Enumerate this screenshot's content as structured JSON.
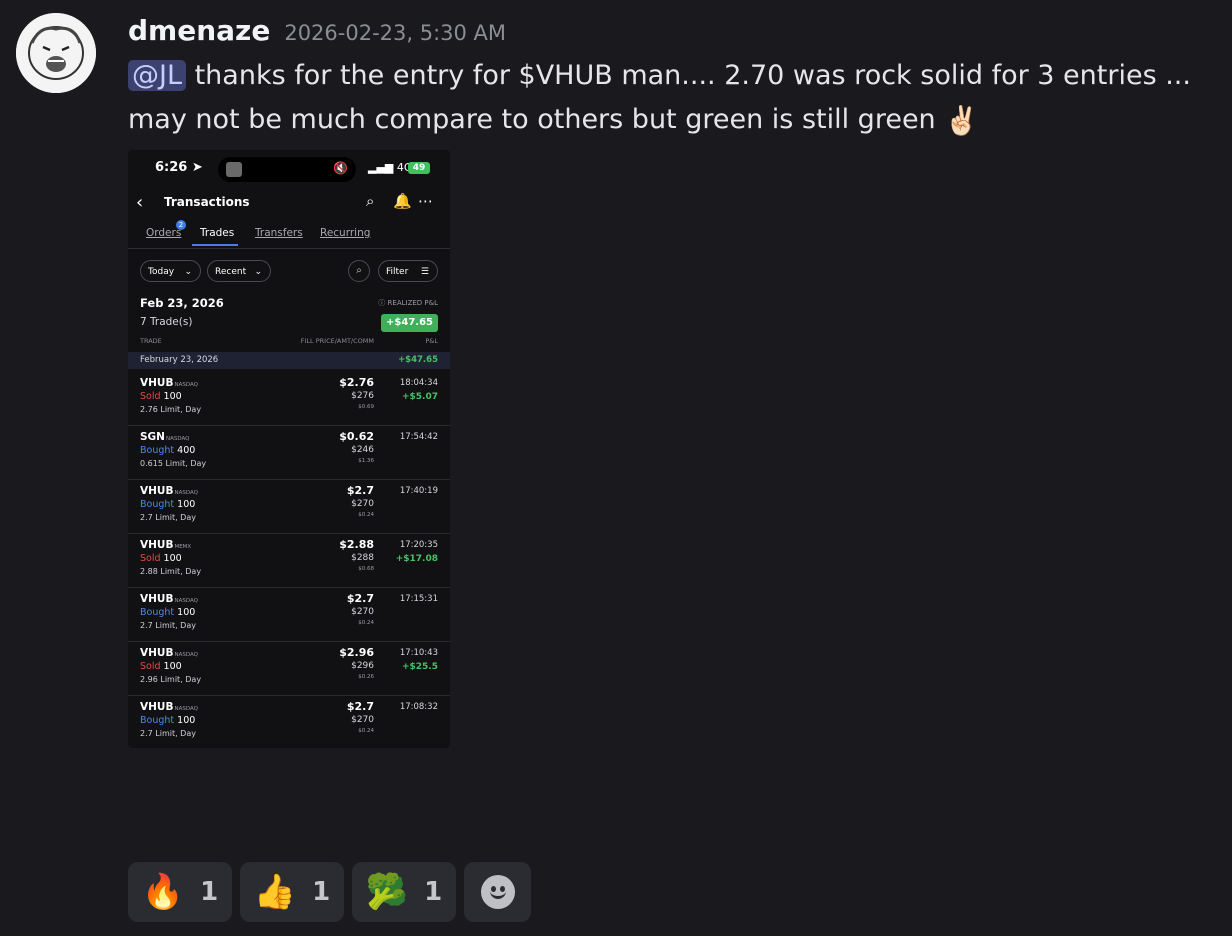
{
  "message": {
    "author": "dmenaze",
    "timestamp": "2026-02-23, 5:30 AM",
    "mention": "@JL",
    "text_line1": " thanks for the entry for $VHUB man.... 2.70 was rock solid for 3 entries ...",
    "text_line2": "may not be much compare to others but green is still green",
    "emoji": "✌🏻"
  },
  "attachment": {
    "status": {
      "time": "6:26",
      "signal": "4G",
      "battery": "49"
    },
    "nav": {
      "title": "Transactions"
    },
    "tabs": [
      {
        "label": "Orders",
        "badge": "2"
      },
      {
        "label": "Trades",
        "active": true
      },
      {
        "label": "Transfers"
      },
      {
        "label": "Recurring"
      }
    ],
    "filters": {
      "period": "Today",
      "sort": "Recent",
      "filter": "Filter"
    },
    "summary": {
      "date": "Feb 23, 2026",
      "trade_count": "7 Trade(s)",
      "realized_label": "REALIZED P&L",
      "realized_value": "+$47.65"
    },
    "columns": {
      "trade": "TRADE",
      "fill": "FILL PRICE/AMT/COMM",
      "pnl": "P&L"
    },
    "day_bar": {
      "date": "February 23, 2026",
      "pnl": "+$47.65"
    },
    "trades": [
      {
        "symbol": "VHUB",
        "exchange": "NASDAQ",
        "side": "Sold",
        "qty": "100",
        "limit": "2.76 Limit, Day",
        "price": "$2.76",
        "amount": "$276",
        "comm": "$0.69",
        "time": "18:04:34",
        "pnl": "+$5.07"
      },
      {
        "symbol": "SGN",
        "exchange": "NASDAQ",
        "side": "Bought",
        "qty": "400",
        "limit": "0.615 Limit, Day",
        "price": "$0.62",
        "amount": "$246",
        "comm": "$1.36",
        "time": "17:54:42",
        "pnl": ""
      },
      {
        "symbol": "VHUB",
        "exchange": "NASDAQ",
        "side": "Bought",
        "qty": "100",
        "limit": "2.7 Limit, Day",
        "price": "$2.7",
        "amount": "$270",
        "comm": "$0.24",
        "time": "17:40:19",
        "pnl": ""
      },
      {
        "symbol": "VHUB",
        "exchange": "MEMX",
        "side": "Sold",
        "qty": "100",
        "limit": "2.88 Limit, Day",
        "price": "$2.88",
        "amount": "$288",
        "comm": "$0.68",
        "time": "17:20:35",
        "pnl": "+$17.08"
      },
      {
        "symbol": "VHUB",
        "exchange": "NASDAQ",
        "side": "Bought",
        "qty": "100",
        "limit": "2.7 Limit, Day",
        "price": "$2.7",
        "amount": "$270",
        "comm": "$0.24",
        "time": "17:15:31",
        "pnl": ""
      },
      {
        "symbol": "VHUB",
        "exchange": "NASDAQ",
        "side": "Sold",
        "qty": "100",
        "limit": "2.96 Limit, Day",
        "price": "$2.96",
        "amount": "$296",
        "comm": "$0.26",
        "time": "17:10:43",
        "pnl": "+$25.5"
      },
      {
        "symbol": "VHUB",
        "exchange": "NASDAQ",
        "side": "Bought",
        "qty": "100",
        "limit": "2.7 Limit, Day",
        "price": "$2.7",
        "amount": "$270",
        "comm": "$0.24",
        "time": "17:08:32",
        "pnl": ""
      }
    ]
  },
  "reactions": [
    {
      "emoji": "🔥",
      "icon": "fire-icon",
      "count": "1"
    },
    {
      "emoji": "👍",
      "icon": "thumbs-up-icon",
      "count": "1"
    },
    {
      "emoji": "🥦",
      "icon": "broccoli-icon",
      "count": "1"
    }
  ]
}
